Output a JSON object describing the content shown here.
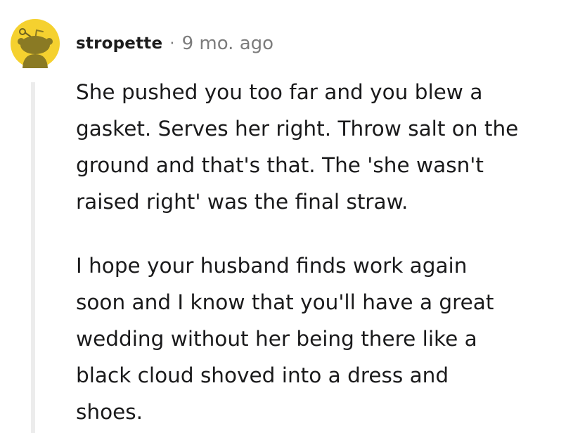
{
  "comment": {
    "username": "stropette",
    "separator": "·",
    "timestamp": "9 mo. ago",
    "avatar_icon": "snoo-avatar-icon",
    "avatar_color": "#f5d12f",
    "body": {
      "p1_lines": [
        "She pushed you too far and you blew a",
        "gasket. Serves her right. Throw salt on the",
        "ground and that's that. The 'she wasn't",
        "raised right' was the final straw."
      ],
      "p2_lines": [
        "I hope your husband finds work again",
        "soon and I know that you'll have a great",
        "wedding without her being there like a",
        "black cloud shoved into a dress and",
        "shoes."
      ]
    }
  }
}
